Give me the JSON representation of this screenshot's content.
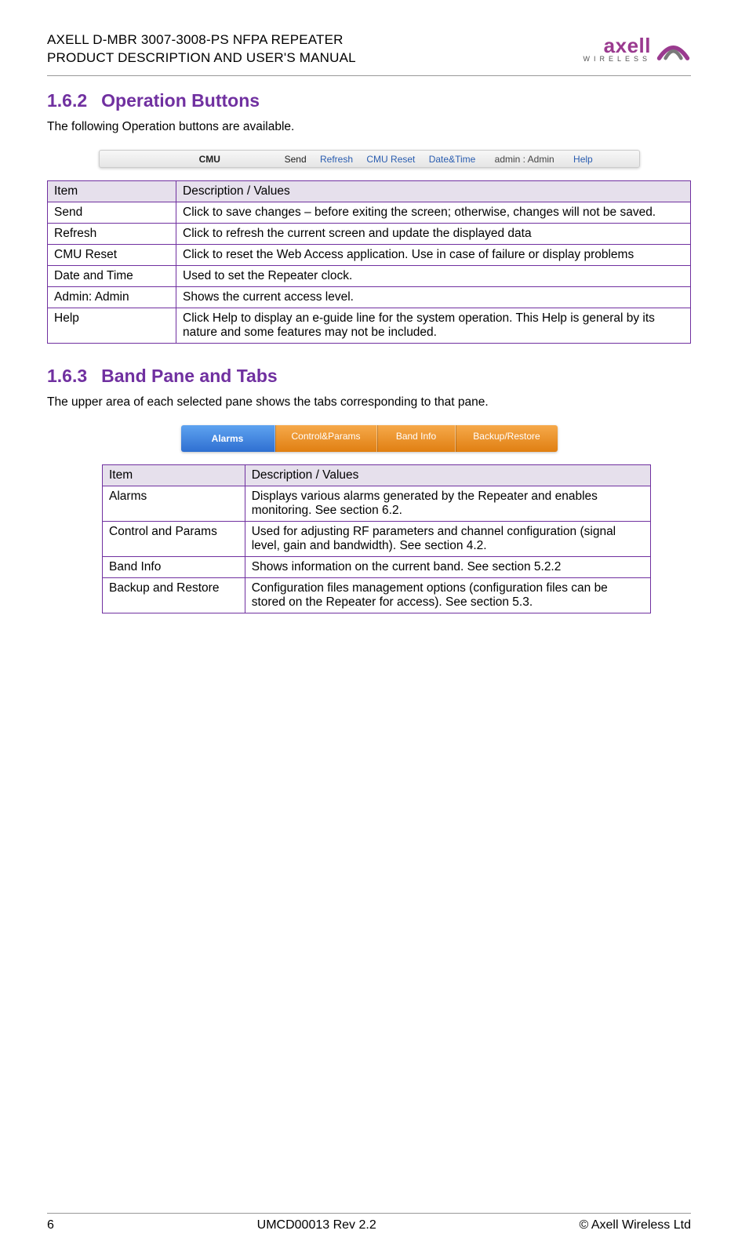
{
  "header": {
    "line1": "AXELL D-MBR 3007-3008-PS NFPA REPEATER",
    "line2": "PRODUCT DESCRIPTION AND USER'S MANUAL",
    "logo_name": "axell",
    "logo_sub": "WIRELESS"
  },
  "section1": {
    "number": "1.6.2",
    "title": "Operation Buttons",
    "intro": "The following Operation buttons are available."
  },
  "cmu_bar": {
    "label": "CMU",
    "items": [
      "Send",
      "Refresh",
      "CMU Reset",
      "Date&Time"
    ],
    "admin": "admin : Admin",
    "help": "Help"
  },
  "table1": {
    "head_item": "Item",
    "head_desc": "Description / Values",
    "rows": [
      {
        "item": "Send",
        "desc": "Click to save changes – before exiting the screen; otherwise, changes will not be saved."
      },
      {
        "item": "Refresh",
        "desc": "Click to refresh the current screen and update the displayed data"
      },
      {
        "item": "CMU Reset",
        "desc": "Click to reset the Web Access application. Use in case of failure or display problems"
      },
      {
        "item": "Date and Time",
        "desc": "Used to set the Repeater clock."
      },
      {
        "item": "Admin: Admin",
        "desc": "Shows the current access level."
      },
      {
        "item": "Help",
        "desc": "Click Help to display an e-guide line for the system operation. This Help is general by its nature and some features may not be included."
      }
    ]
  },
  "section2": {
    "number": "1.6.3",
    "title": "Band Pane and Tabs",
    "intro": "The upper area of each selected pane shows the tabs corresponding to that pane."
  },
  "tabs": [
    "Alarms",
    "Control&Params",
    "Band Info",
    "Backup/Restore"
  ],
  "table2": {
    "head_item": "Item",
    "head_desc": "Description / Values",
    "rows": [
      {
        "item": "Alarms",
        "desc": "Displays various alarms generated by the Repeater and enables monitoring. See section 6.2."
      },
      {
        "item": "Control and Params",
        "desc": "Used for adjusting RF parameters and channel configuration (signal level, gain and bandwidth). See section 4.2."
      },
      {
        "item": "Band Info",
        "desc": "Shows information on the current band. See section 5.2.2"
      },
      {
        "item": "Backup and Restore",
        "desc": "Configuration files management options (configuration files can be stored on the Repeater for access). See section 5.3."
      }
    ]
  },
  "footer": {
    "page": "6",
    "rev": "UMCD00013 Rev 2.2",
    "copy": "© Axell Wireless Ltd"
  }
}
